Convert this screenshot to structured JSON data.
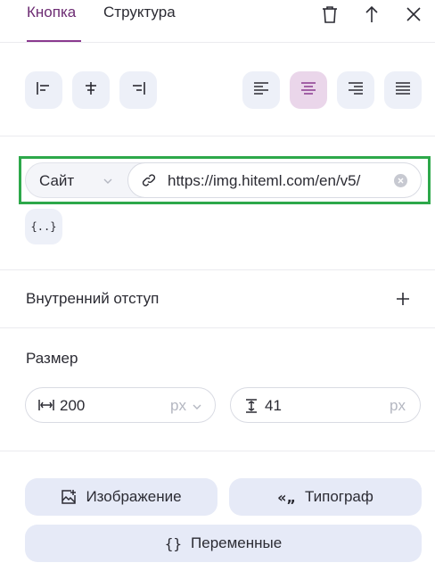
{
  "tabs": [
    {
      "label": "Кнопка",
      "active": true
    },
    {
      "label": "Структура",
      "active": false
    }
  ],
  "header_icons": [
    "trash-icon",
    "move-up-icon",
    "close-icon"
  ],
  "alignment": {
    "block_align": [
      "align-left-icon",
      "align-center-icon",
      "align-right-icon"
    ],
    "text_align": [
      "text-align-left-icon",
      "text-align-center-icon",
      "text-align-right-icon",
      "text-align-justify-icon"
    ],
    "active_text_align": "center"
  },
  "link": {
    "type": "Сайт",
    "url": "https://img.hiteml.com/en/v5/"
  },
  "variables_glyph": "{..}",
  "padding": {
    "label": "Внутренний отступ"
  },
  "size": {
    "label": "Размер",
    "width": "200",
    "width_unit": "px",
    "height": "41",
    "height_unit": "px"
  },
  "buttons": {
    "image": "Изображение",
    "typograph": "Типограф",
    "typograph_glyph": "«„",
    "variables": "Переменные",
    "variables_glyph": "{}"
  },
  "colors": {
    "accent": "#8a3a8f",
    "active_bg": "#ead6ea",
    "button_bg": "#edf0f8",
    "highlight": "#2da84a"
  }
}
